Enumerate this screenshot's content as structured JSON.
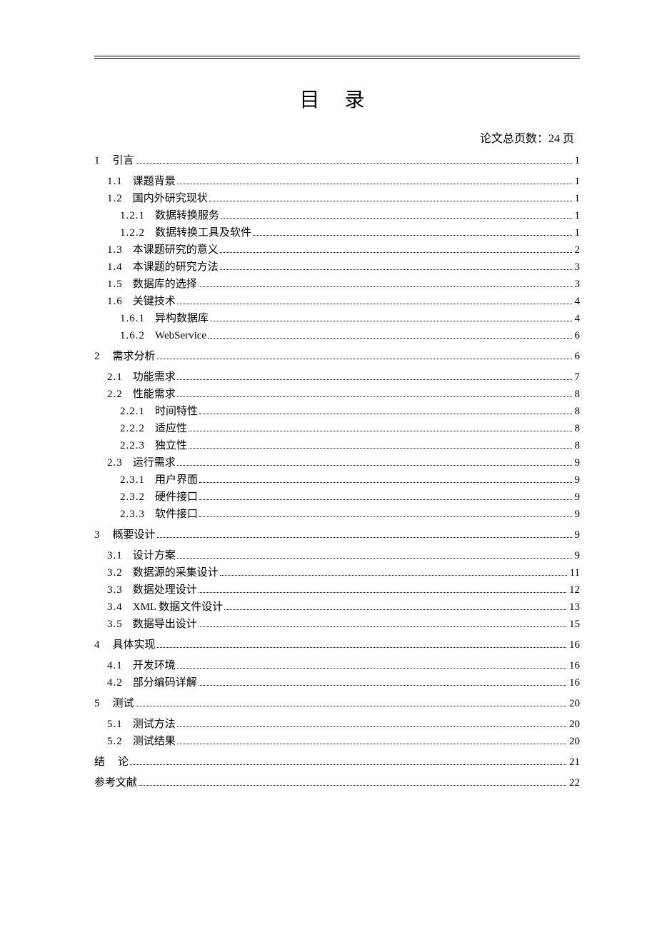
{
  "title": "目 录",
  "total_pages_label": "论文总页数：24 页",
  "toc": [
    {
      "level": "l1",
      "num": "1",
      "label": "引言",
      "page": "1"
    },
    {
      "level": "l2",
      "num": "1.1",
      "label": "课题背景",
      "page": "1"
    },
    {
      "level": "l2",
      "num": "1.2",
      "label": "国内外研究现状",
      "page": "1"
    },
    {
      "level": "l3",
      "num": "1.2.1",
      "label": "数据转换服务",
      "page": "1"
    },
    {
      "level": "l3",
      "num": "1.2.2",
      "label": "数据转换工具及软件",
      "page": "1"
    },
    {
      "level": "l2",
      "num": "1.3",
      "label": "本课题研究的意义",
      "page": "2"
    },
    {
      "level": "l2",
      "num": "1.4",
      "label": "本课题的研究方法",
      "page": "3"
    },
    {
      "level": "l2",
      "num": "1.5",
      "label": "数据库的选择",
      "page": "3"
    },
    {
      "level": "l2",
      "num": "1.6",
      "label": "关键技术",
      "page": "4"
    },
    {
      "level": "l3",
      "num": "1.6.1",
      "label": "异构数据库",
      "page": "4"
    },
    {
      "level": "l3",
      "num": "1.6.2",
      "label": "WebService",
      "page": "6"
    },
    {
      "level": "l1",
      "num": "2",
      "label": "需求分析",
      "page": "6"
    },
    {
      "level": "l2",
      "num": "2.1",
      "label": "功能需求",
      "page": "7"
    },
    {
      "level": "l2",
      "num": "2.2",
      "label": "性能需求",
      "page": "8"
    },
    {
      "level": "l3",
      "num": "2.2.1",
      "label": "时间特性",
      "page": "8"
    },
    {
      "level": "l3",
      "num": "2.2.2",
      "label": "适应性",
      "page": "8"
    },
    {
      "level": "l3",
      "num": "2.2.3",
      "label": "独立性",
      "page": "8"
    },
    {
      "level": "l2",
      "num": "2.3",
      "label": "运行需求",
      "page": "9"
    },
    {
      "level": "l3",
      "num": "2.3.1",
      "label": "用户界面",
      "page": "9"
    },
    {
      "level": "l3",
      "num": "2.3.2",
      "label": "硬件接口",
      "page": "9"
    },
    {
      "level": "l3",
      "num": "2.3.3",
      "label": "软件接口",
      "page": "9"
    },
    {
      "level": "l1",
      "num": "3",
      "label": "概要设计",
      "page": "9"
    },
    {
      "level": "l2",
      "num": "3.1",
      "label": "设计方案",
      "page": "9"
    },
    {
      "level": "l2",
      "num": "3.2",
      "label": "数据源的采集设计",
      "page": "11"
    },
    {
      "level": "l2",
      "num": "3.3",
      "label": "数据处理设计",
      "page": "12"
    },
    {
      "level": "l2",
      "num": "3.4",
      "label": "XML 数据文件设计",
      "page": "13"
    },
    {
      "level": "l2",
      "num": "3.5",
      "label": "数据导出设计",
      "page": "15"
    },
    {
      "level": "l1",
      "num": "4",
      "label": "具体实现",
      "page": "16"
    },
    {
      "level": "l2",
      "num": "4.1",
      "label": "开发环境",
      "page": "16"
    },
    {
      "level": "l2",
      "num": "4.2",
      "label": "部分编码详解",
      "page": "16"
    },
    {
      "level": "l1",
      "num": "5",
      "label": "测试",
      "page": "20"
    },
    {
      "level": "l2",
      "num": "5.1",
      "label": "测试方法",
      "page": "20"
    },
    {
      "level": "l2",
      "num": "5.2",
      "label": "测试结果",
      "page": "20"
    },
    {
      "level": "final",
      "num": "结",
      "label": "论",
      "page": "21"
    },
    {
      "level": "final",
      "num": "",
      "label": "参考文献",
      "page": "22"
    }
  ]
}
